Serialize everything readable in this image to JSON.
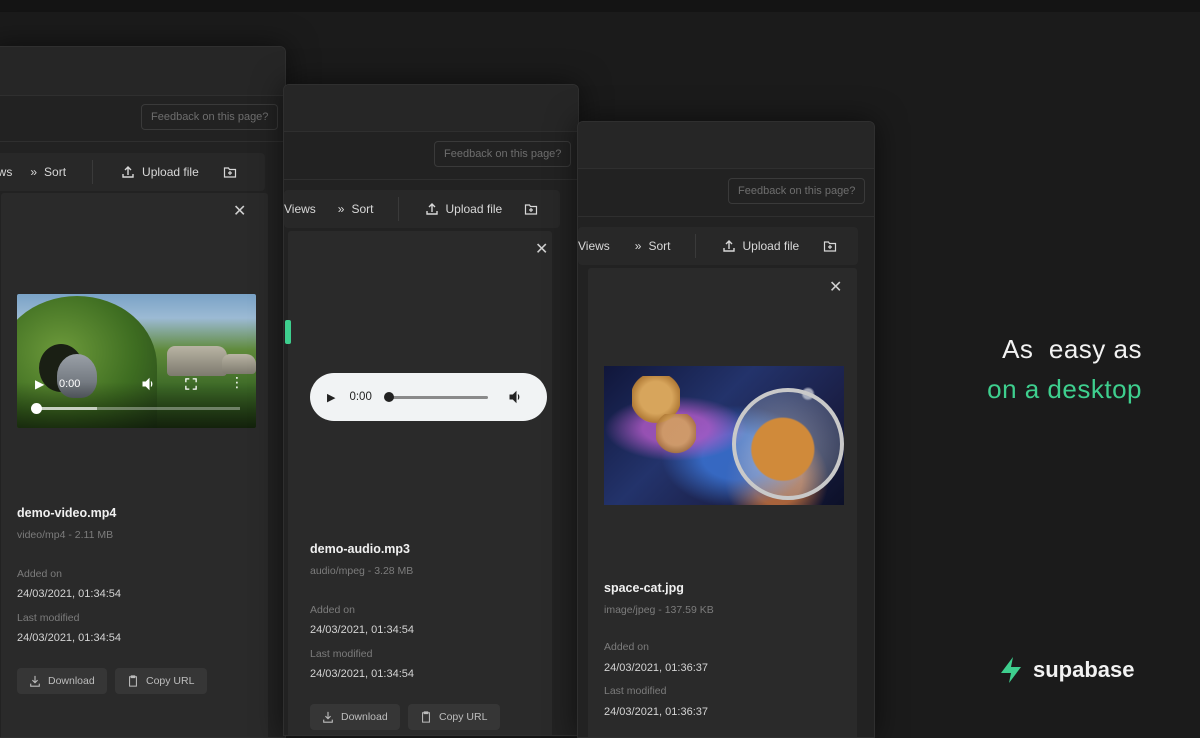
{
  "windows": [
    {
      "feedback": "Feedback on this page?",
      "toolbar": {
        "views": "ews",
        "sort": "Sort",
        "upload": "Upload file"
      },
      "file": {
        "name": "demo-video.mp4",
        "meta": "video/mp4 - 2.11 MB",
        "added_label": "Added on",
        "added_value": "24/03/2021, 01:34:54",
        "modified_label": "Last modified",
        "modified_value": "24/03/2021, 01:34:54"
      },
      "player": {
        "time": "0:00"
      },
      "buttons": {
        "download": "Download",
        "copy": "Copy URL"
      }
    },
    {
      "feedback": "Feedback on this page?",
      "toolbar": {
        "views": "Views",
        "sort": "Sort",
        "upload": "Upload file"
      },
      "file": {
        "name": "demo-audio.mp3",
        "meta": "audio/mpeg - 3.28 MB",
        "added_label": "Added on",
        "added_value": "24/03/2021, 01:34:54",
        "modified_label": "Last modified",
        "modified_value": "24/03/2021, 01:34:54"
      },
      "player": {
        "time": "0:00"
      },
      "buttons": {
        "download": "Download",
        "copy": "Copy URL"
      }
    },
    {
      "feedback": "Feedback on this page?",
      "toolbar": {
        "views": "Views",
        "sort": "Sort",
        "upload": "Upload file"
      },
      "file": {
        "name": "space-cat.jpg",
        "meta": "image/jpeg - 137.59 KB",
        "added_label": "Added on",
        "added_value": "24/03/2021, 01:36:37",
        "modified_label": "Last modified",
        "modified_value": "24/03/2021, 01:36:37"
      }
    }
  ],
  "headline": {
    "line1": "As  easy as",
    "line2": "on a desktop"
  },
  "brand": {
    "name": "supabase"
  },
  "colors": {
    "accent": "#3ecf8e",
    "background": "#1b1b1b",
    "panel": "#2a2a2a"
  },
  "icons": [
    "views-icon",
    "sort-icon",
    "upload-icon",
    "new-folder-icon",
    "close-icon",
    "play-icon",
    "volume-icon",
    "fullscreen-icon",
    "more-icon",
    "download-icon",
    "copy-icon",
    "supabase-logo-icon"
  ]
}
